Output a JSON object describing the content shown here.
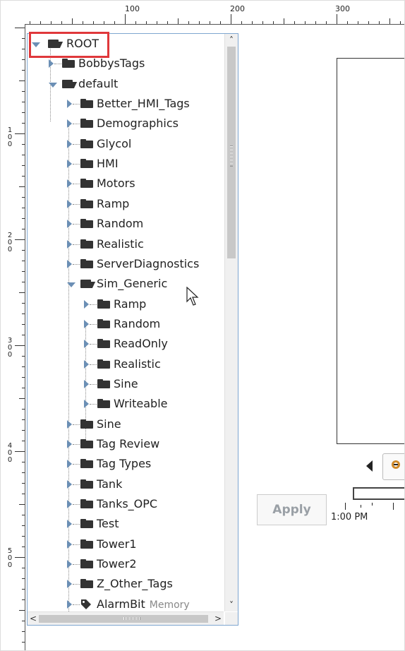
{
  "ruler": {
    "top_labels": [
      "100",
      "200",
      "300"
    ],
    "left_labels": [
      "100",
      "200",
      "300",
      "400",
      "500"
    ]
  },
  "tree": {
    "root": {
      "label": "ROOT",
      "expanded": true
    },
    "rows": [
      {
        "label": "BobbysTags",
        "level": 1,
        "type": "folder",
        "expanded": false
      },
      {
        "label": "default",
        "level": 1,
        "type": "folder",
        "expanded": true
      },
      {
        "label": "Better_HMI_Tags",
        "level": 2,
        "type": "folder",
        "expanded": false
      },
      {
        "label": "Demographics",
        "level": 2,
        "type": "folder",
        "expanded": false
      },
      {
        "label": "Glycol",
        "level": 2,
        "type": "folder",
        "expanded": false
      },
      {
        "label": "HMI",
        "level": 2,
        "type": "folder",
        "expanded": false
      },
      {
        "label": "Motors",
        "level": 2,
        "type": "folder",
        "expanded": false
      },
      {
        "label": "Ramp",
        "level": 2,
        "type": "folder",
        "expanded": false
      },
      {
        "label": "Random",
        "level": 2,
        "type": "folder",
        "expanded": false
      },
      {
        "label": "Realistic",
        "level": 2,
        "type": "folder",
        "expanded": false
      },
      {
        "label": "ServerDiagnostics",
        "level": 2,
        "type": "folder",
        "expanded": false
      },
      {
        "label": "Sim_Generic",
        "level": 2,
        "type": "folder",
        "expanded": true
      },
      {
        "label": "Ramp",
        "level": 3,
        "type": "folder",
        "expanded": false
      },
      {
        "label": "Random",
        "level": 3,
        "type": "folder",
        "expanded": false
      },
      {
        "label": "ReadOnly",
        "level": 3,
        "type": "folder",
        "expanded": false
      },
      {
        "label": "Realistic",
        "level": 3,
        "type": "folder",
        "expanded": false
      },
      {
        "label": "Sine",
        "level": 3,
        "type": "folder",
        "expanded": false
      },
      {
        "label": "Writeable",
        "level": 3,
        "type": "folder",
        "expanded": false
      },
      {
        "label": "Sine",
        "level": 2,
        "type": "folder",
        "expanded": false
      },
      {
        "label": "Tag Review",
        "level": 2,
        "type": "folder",
        "expanded": false
      },
      {
        "label": "Tag Types",
        "level": 2,
        "type": "folder",
        "expanded": false
      },
      {
        "label": "Tank",
        "level": 2,
        "type": "folder",
        "expanded": false
      },
      {
        "label": "Tanks_OPC",
        "level": 2,
        "type": "folder",
        "expanded": false
      },
      {
        "label": "Test",
        "level": 2,
        "type": "folder",
        "expanded": false
      },
      {
        "label": "Tower1",
        "level": 2,
        "type": "folder",
        "expanded": false
      },
      {
        "label": "Tower2",
        "level": 2,
        "type": "folder",
        "expanded": false
      },
      {
        "label": "Z_Other_Tags",
        "level": 2,
        "type": "folder",
        "expanded": false
      },
      {
        "label": "AlarmBit",
        "level": 2,
        "type": "tag",
        "expanded": false,
        "badge": "Memory"
      }
    ]
  },
  "controls": {
    "apply_label": "Apply",
    "time_label": "1:00 PM"
  },
  "colors": {
    "highlight": "#e0383b",
    "panel_border": "#7ea6d0",
    "expander": "#6b8fb5",
    "disabled_text": "#9aa0a6"
  },
  "icons": {
    "folder": "folder-icon",
    "open_folder": "open-folder-icon",
    "tag": "tag-icon",
    "zoom_out": "zoom-out-icon"
  }
}
